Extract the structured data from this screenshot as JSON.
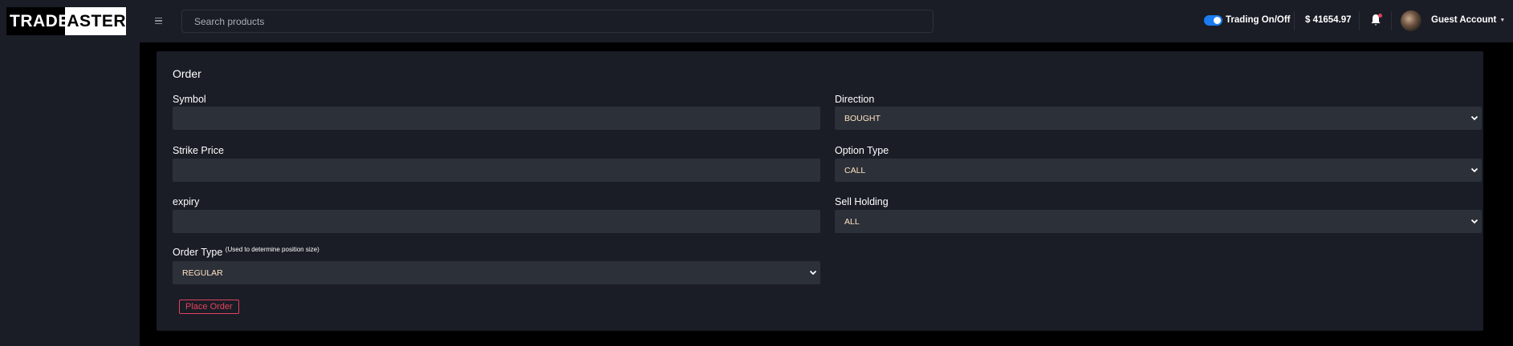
{
  "brand": {
    "word1": "TRADE",
    "word2_tail": "ASTER"
  },
  "header": {
    "search_placeholder": "Search products",
    "trading_toggle_label": "Trading On/Off",
    "trading_enabled": true,
    "balance": "$ 41654.97",
    "account_name": "Guest Account",
    "colors": {
      "accent": "#1a7cf0",
      "notification_dot": "#e2425c"
    }
  },
  "order_form": {
    "title": "Order",
    "fields": {
      "symbol": {
        "label": "Symbol",
        "value": ""
      },
      "direction": {
        "label": "Direction",
        "selected": "BOUGHT"
      },
      "strike_price": {
        "label": "Strike Price",
        "value": ""
      },
      "option_type": {
        "label": "Option Type",
        "selected": "CALL"
      },
      "expiry": {
        "label": "expiry",
        "value": ""
      },
      "sell_holding": {
        "label": "Sell Holding",
        "selected": "ALL"
      },
      "order_type": {
        "label": "Order Type",
        "hint": "(Used to determine position size)",
        "selected": "REGULAR"
      }
    },
    "submit_label": "Place Order",
    "colors": {
      "submit": "#e2425c",
      "select_text": "#ffe3c2"
    }
  }
}
